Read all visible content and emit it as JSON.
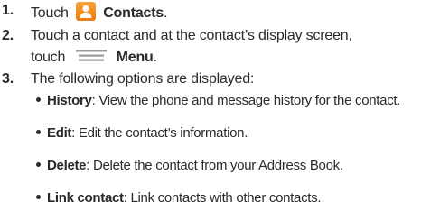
{
  "steps": [
    {
      "number": "1.",
      "pre": "Touch",
      "icon": "contacts-icon",
      "bold": "Contacts",
      "post": "."
    },
    {
      "number": "2.",
      "line1": "Touch a contact and at the contact’s display screen,",
      "line2_pre": "touch",
      "icon": "menu-icon",
      "bold": "Menu",
      "post": "."
    },
    {
      "number": "3.",
      "text": "The following options are displayed:"
    }
  ],
  "options": [
    {
      "term": "History",
      "desc": ": View the phone and message history for the contact."
    },
    {
      "term": "Edit",
      "desc": ": Edit the contact’s information."
    },
    {
      "term": "Delete",
      "desc": ": Delete the contact from your Address Book."
    },
    {
      "term": "Link contact",
      "desc": ": Link contacts with other contacts."
    }
  ],
  "colors": {
    "contacts_icon": "#ef8a1e",
    "menu_icon": "#9a9a9a",
    "text": "#2a2a2a"
  }
}
